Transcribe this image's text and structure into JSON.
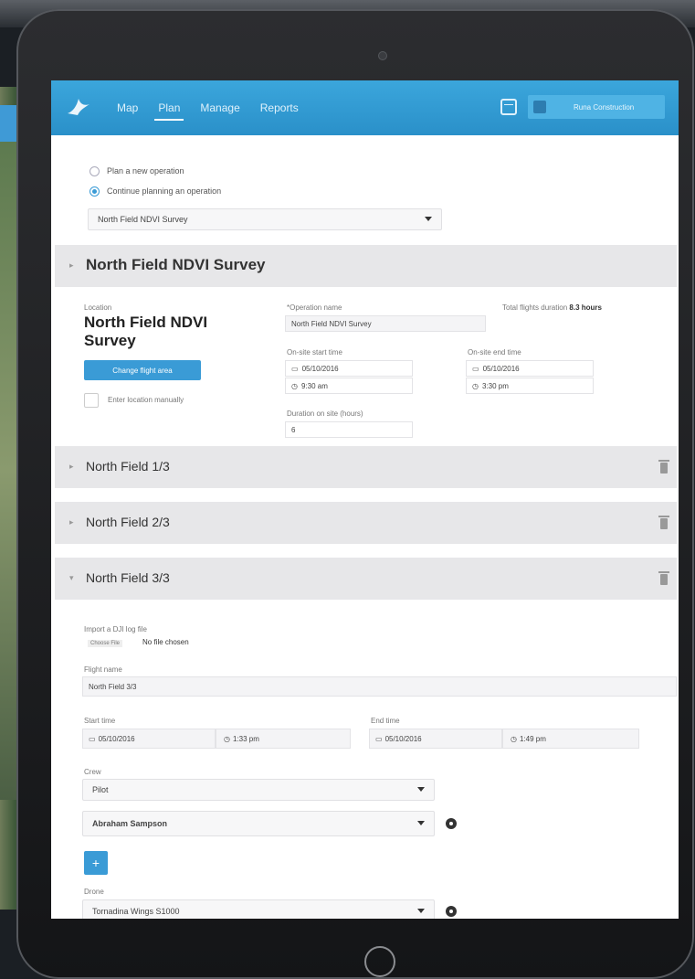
{
  "nav": {
    "items": [
      "Map",
      "Plan",
      "Manage",
      "Reports"
    ],
    "active": "Plan",
    "user_label": "Runa Construction"
  },
  "plan": {
    "option_new": "Plan a new operation",
    "option_continue": "Continue planning an operation",
    "selected_operation": "North Field NDVI Survey"
  },
  "operation": {
    "header": "North Field NDVI Survey",
    "location_label": "Location",
    "location_name": "North Field NDVI Survey",
    "change_area_button": "Change flight area",
    "manual_location_label": "Enter location manually",
    "operation_name_label": "*Operation name",
    "operation_name_value": "North Field NDVI Survey",
    "total_duration_label": "Total flights duration",
    "total_duration_value": "8.3 hours",
    "start_label": "On-site start time",
    "start_date": "05/10/2016",
    "start_time": "9:30 am",
    "end_label": "On-site end time",
    "end_date": "05/10/2016",
    "end_time": "3:30 pm",
    "duration_label": "Duration on site (hours)",
    "duration_value": "6"
  },
  "flights": [
    {
      "title": "North Field 1/3"
    },
    {
      "title": "North Field 2/3"
    },
    {
      "title": "North Field 3/3"
    }
  ],
  "flight3": {
    "import_label": "Import a DJI log file",
    "choose_file_button": "Choose File",
    "no_file_text": "No file chosen",
    "flight_name_label": "Flight name",
    "flight_name_value": "North Field 3/3",
    "start_time_label": "Start time",
    "start_date": "05/10/2016",
    "start_time": "1:33 pm",
    "end_time_label": "End time",
    "end_date": "05/10/2016",
    "end_time": "1:49 pm",
    "crew_label": "Crew",
    "crew_role": "Pilot",
    "crew_member": "Abraham Sampson",
    "add_button": "+",
    "drone_label": "Drone",
    "drone_value": "Tornadina Wings S1000"
  }
}
